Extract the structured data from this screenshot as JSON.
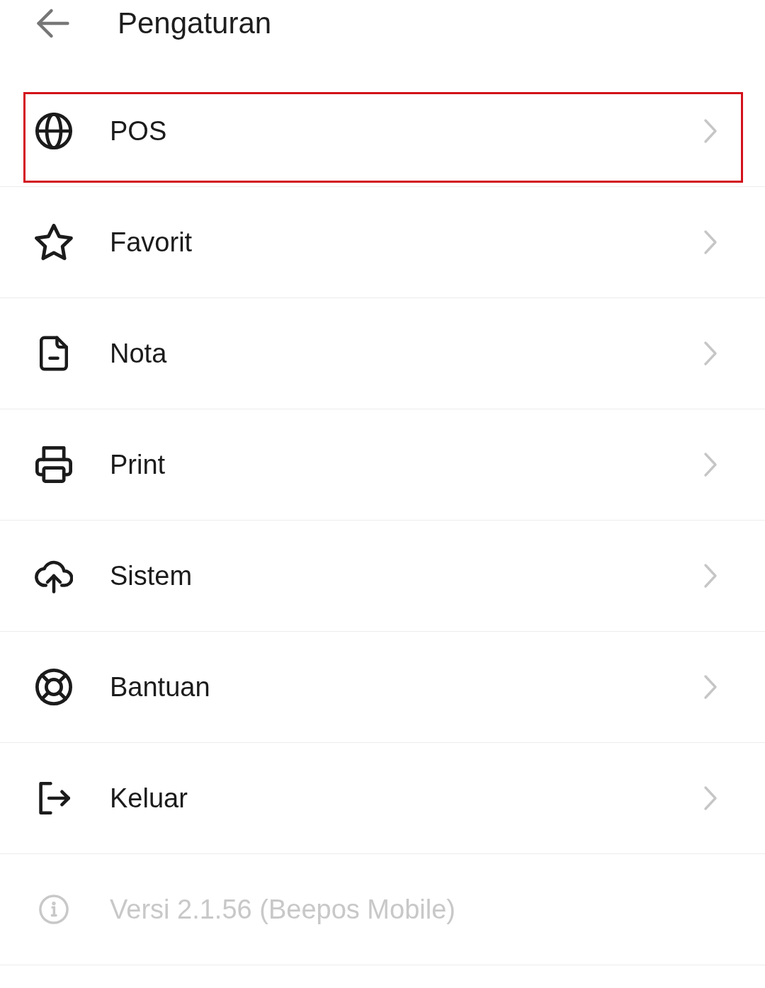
{
  "header": {
    "title": "Pengaturan"
  },
  "items": [
    {
      "label": "POS",
      "highlighted": true
    },
    {
      "label": "Favorit",
      "highlighted": false
    },
    {
      "label": "Nota",
      "highlighted": false
    },
    {
      "label": "Print",
      "highlighted": false
    },
    {
      "label": "Sistem",
      "highlighted": false
    },
    {
      "label": "Bantuan",
      "highlighted": false
    },
    {
      "label": "Keluar",
      "highlighted": false
    }
  ],
  "version": {
    "text": "Versi 2.1.56 (Beepos Mobile)"
  }
}
